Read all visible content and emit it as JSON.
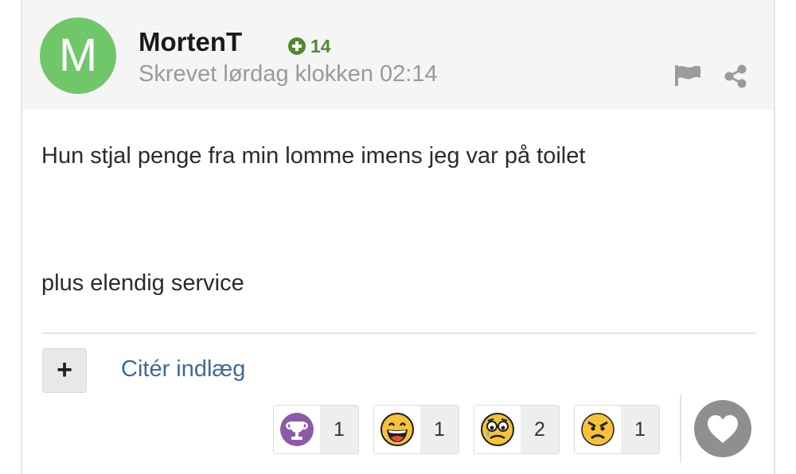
{
  "post": {
    "avatar_letter": "M",
    "author": "MortenT",
    "reputation": "14",
    "date": "Skrevet lørdag klokken 02:14",
    "paragraphs": [
      "Hun stjal penge fra min lomme imens jeg var på toilet",
      "plus elendig service"
    ]
  },
  "actions": {
    "multiquote_label": "+",
    "quote_label": "Citér indlæg"
  },
  "reactions": [
    {
      "icon": "trophy-icon",
      "count": "1"
    },
    {
      "icon": "laughing-face-icon",
      "count": "1"
    },
    {
      "icon": "sad-face-icon",
      "count": "2"
    },
    {
      "icon": "angry-face-icon",
      "count": "1"
    }
  ],
  "colors": {
    "avatar": "#6fc76a",
    "reputation": "#4e8a32",
    "link": "#3e6a97",
    "header_bg": "#f5f5f5"
  }
}
